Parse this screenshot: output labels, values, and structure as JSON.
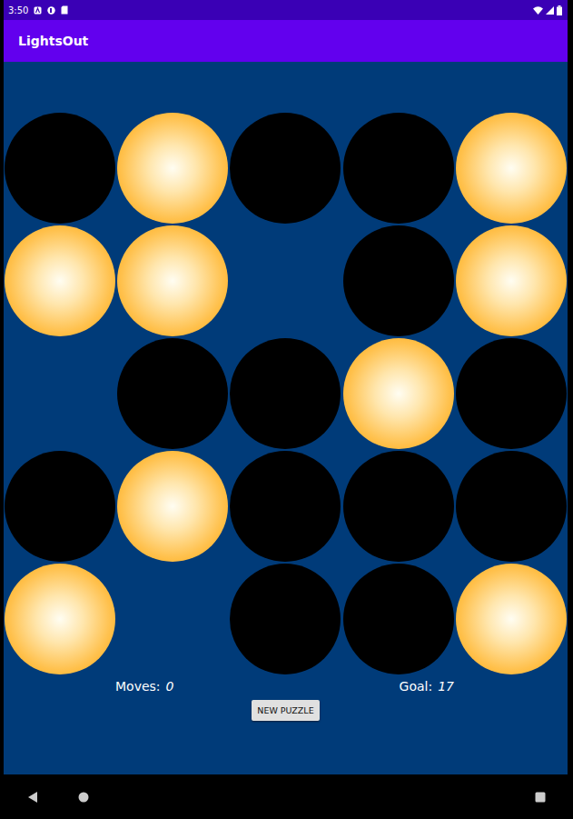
{
  "status_bar": {
    "time": "3:50"
  },
  "app_bar": {
    "title": "LightsOut"
  },
  "board": {
    "rows": [
      [
        {
          "kind": "off"
        },
        {
          "kind": "on"
        },
        {
          "kind": "off"
        },
        {
          "kind": "off"
        },
        {
          "kind": "on"
        }
      ],
      [
        {
          "kind": "on"
        },
        {
          "kind": "on"
        },
        {
          "kind": "empty"
        },
        {
          "kind": "off"
        },
        {
          "kind": "on"
        }
      ],
      [
        {
          "kind": "empty"
        },
        {
          "kind": "off"
        },
        {
          "kind": "off"
        },
        {
          "kind": "on"
        },
        {
          "kind": "off"
        }
      ],
      [
        {
          "kind": "off"
        },
        {
          "kind": "on"
        },
        {
          "kind": "off"
        },
        {
          "kind": "off"
        },
        {
          "kind": "off"
        }
      ],
      [
        {
          "kind": "on"
        },
        {
          "kind": "empty"
        },
        {
          "kind": "off"
        },
        {
          "kind": "off"
        },
        {
          "kind": "on"
        }
      ]
    ]
  },
  "stats": {
    "moves_label": "Moves:",
    "moves": "0",
    "goal_label": "Goal:",
    "goal": "17"
  },
  "buttons": [
    "NEW PUZZLE"
  ]
}
